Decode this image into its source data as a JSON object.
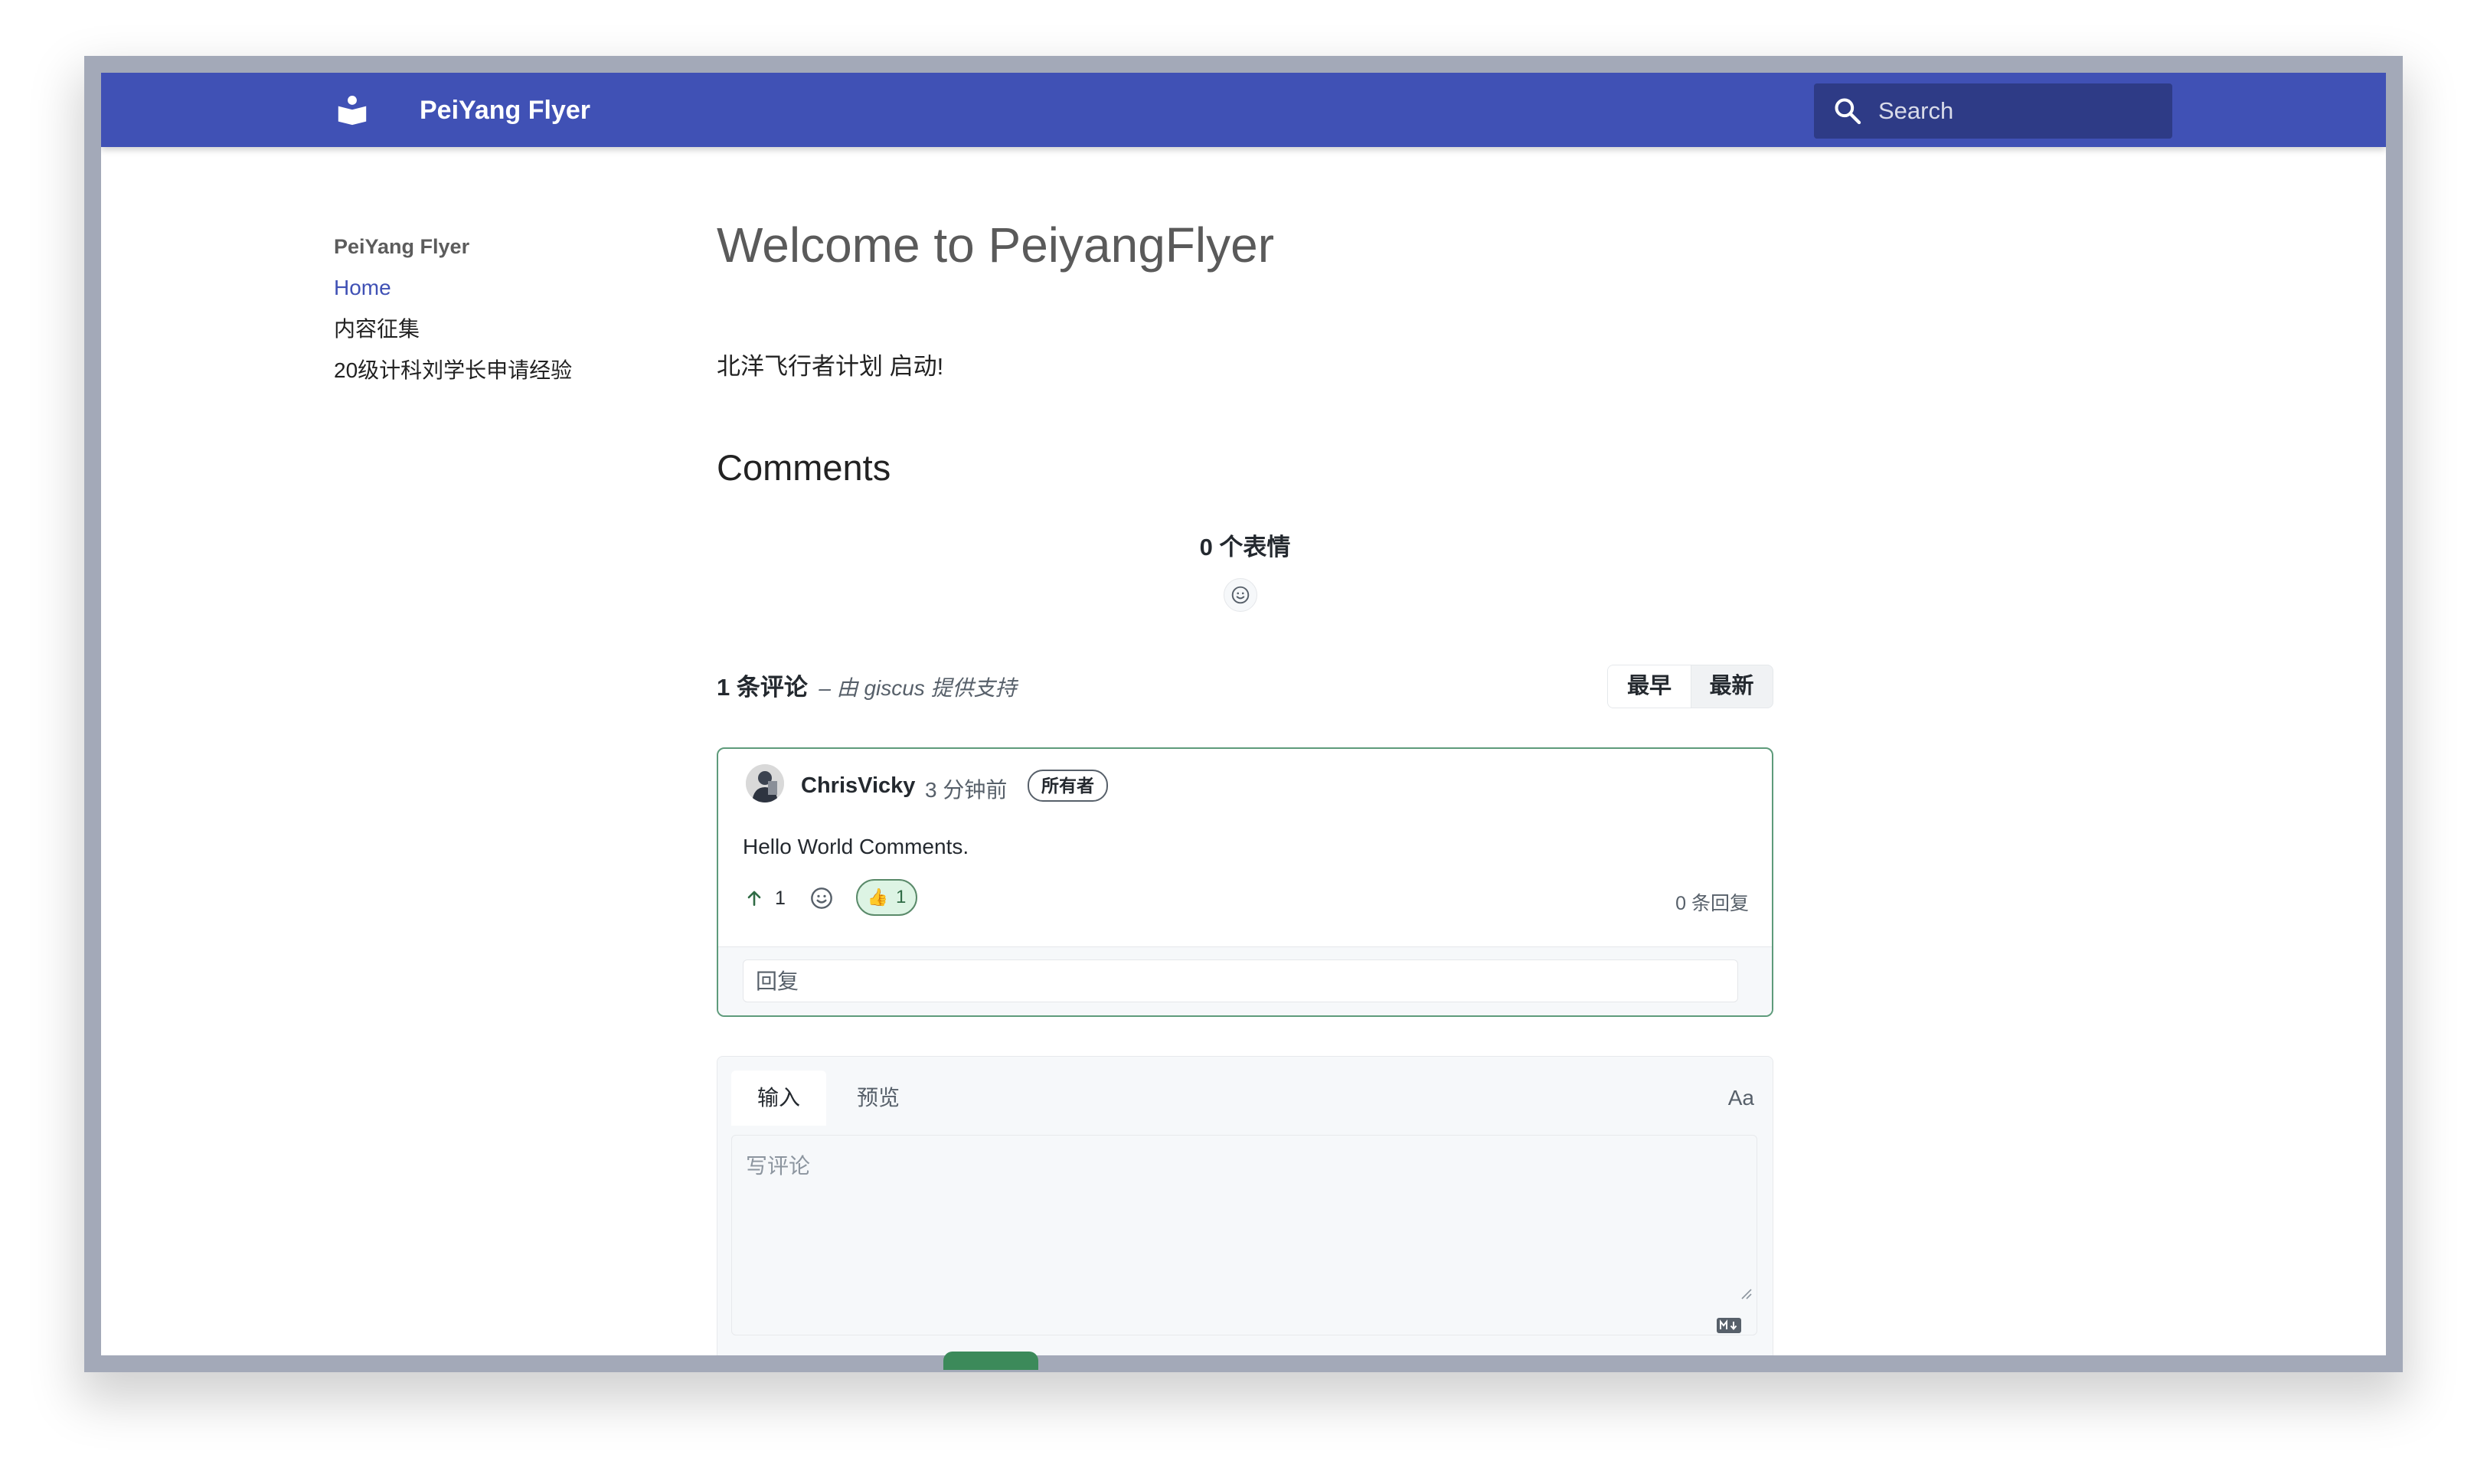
{
  "header": {
    "site_title": "PeiYang Flyer",
    "search_placeholder": "Search",
    "logo_icon": "book-icon",
    "color": "#4051b5"
  },
  "sidebar": {
    "title": "PeiYang Flyer",
    "items": [
      {
        "label": "Home",
        "active": true
      },
      {
        "label": "内容征集",
        "active": false
      },
      {
        "label": "20级计科刘学长申请经验",
        "active": false
      }
    ]
  },
  "content": {
    "title": "Welcome to PeiyangFlyer",
    "intro": "北洋飞行者计划 启动!",
    "comments_heading": "Comments"
  },
  "giscus": {
    "reactions_count": "0 个表情",
    "comment_count": "1 条评论",
    "powered_by": "– 由 giscus 提供支持",
    "sort": {
      "oldest": "最早",
      "newest": "最新",
      "selected": "最早"
    },
    "comment": {
      "author": "ChrisVicky",
      "time": "3 分钟前",
      "badge": "所有者",
      "body": "Hello World Comments.",
      "upvotes": "1",
      "reaction_emoji": "👍",
      "reaction_count": "1",
      "replies": "0 条回复",
      "reply_placeholder": "回复"
    },
    "editor": {
      "tab_write": "输入",
      "tab_preview": "预览",
      "format_toggle": "Aa",
      "placeholder": "写评论"
    },
    "accent_color": "#3c8a5a"
  }
}
